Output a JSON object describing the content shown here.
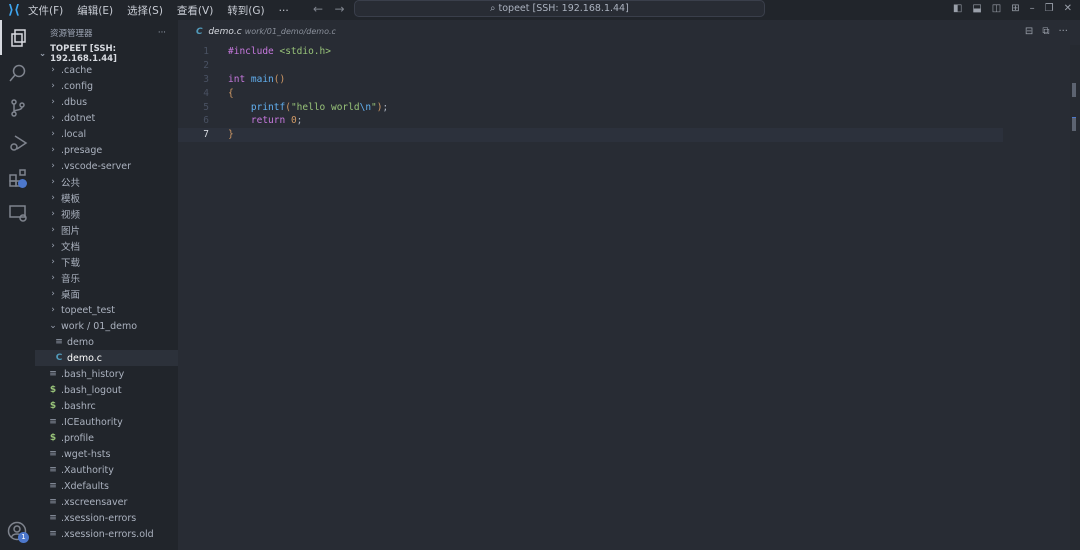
{
  "menu": [
    "文件(F)",
    "编辑(E)",
    "选择(S)",
    "查看(V)",
    "转到(G)",
    "···"
  ],
  "command_center": "topeet [SSH: 192.168.1.44]",
  "explorer": {
    "title": "资源管理器",
    "more": "···",
    "root": "TOPEET [SSH: 192.168.1.44]",
    "items": [
      {
        "type": "folder",
        "label": ".cache",
        "depth": 1
      },
      {
        "type": "folder",
        "label": ".config",
        "depth": 1
      },
      {
        "type": "folder",
        "label": ".dbus",
        "depth": 1
      },
      {
        "type": "folder",
        "label": ".dotnet",
        "depth": 1
      },
      {
        "type": "folder",
        "label": ".local",
        "depth": 1
      },
      {
        "type": "folder",
        "label": ".presage",
        "depth": 1
      },
      {
        "type": "folder",
        "label": ".vscode-server",
        "depth": 1
      },
      {
        "type": "folder",
        "label": "公共",
        "depth": 1
      },
      {
        "type": "folder",
        "label": "模板",
        "depth": 1
      },
      {
        "type": "folder",
        "label": "视频",
        "depth": 1
      },
      {
        "type": "folder",
        "label": "图片",
        "depth": 1
      },
      {
        "type": "folder",
        "label": "文档",
        "depth": 1
      },
      {
        "type": "folder",
        "label": "下载",
        "depth": 1
      },
      {
        "type": "folder",
        "label": "音乐",
        "depth": 1
      },
      {
        "type": "folder",
        "label": "桌面",
        "depth": 1
      },
      {
        "type": "folder",
        "label": "topeet_test",
        "depth": 1
      },
      {
        "type": "open-folder",
        "label": "work / 01_demo",
        "depth": 1
      },
      {
        "type": "file",
        "label": "demo",
        "depth": 2
      },
      {
        "type": "c",
        "label": "demo.c",
        "depth": 2,
        "selected": true
      },
      {
        "type": "file",
        "label": ".bash_history",
        "depth": 1
      },
      {
        "type": "shell",
        "label": ".bash_logout",
        "depth": 1
      },
      {
        "type": "shell",
        "label": ".bashrc",
        "depth": 1
      },
      {
        "type": "file",
        "label": ".ICEauthority",
        "depth": 1
      },
      {
        "type": "shell",
        "label": ".profile",
        "depth": 1
      },
      {
        "type": "file",
        "label": ".wget-hsts",
        "depth": 1
      },
      {
        "type": "file",
        "label": ".Xauthority",
        "depth": 1
      },
      {
        "type": "file",
        "label": ".Xdefaults",
        "depth": 1
      },
      {
        "type": "file",
        "label": ".xscreensaver",
        "depth": 1
      },
      {
        "type": "file",
        "label": ".xsession-errors",
        "depth": 1
      },
      {
        "type": "file",
        "label": ".xsession-errors.old",
        "depth": 1
      }
    ]
  },
  "tab": {
    "name": "demo.c",
    "path": "work/01_demo/demo.c",
    "icon": "C"
  },
  "account_badge": "1",
  "code": {
    "current_line": 7,
    "lines": [
      [
        [
          "kw",
          "#include "
        ],
        [
          "str",
          "<stdio.h>"
        ]
      ],
      [],
      [
        [
          "kw",
          "int "
        ],
        [
          "fn",
          "main"
        ],
        [
          "br",
          "()"
        ]
      ],
      [
        [
          "br",
          "{"
        ]
      ],
      [
        [
          "pn",
          "    "
        ],
        [
          "fn",
          "printf"
        ],
        [
          "br",
          "("
        ],
        [
          "str",
          "\"hello world"
        ],
        [
          "fn",
          "\\n"
        ],
        [
          "str",
          "\""
        ],
        [
          "br",
          ")"
        ],
        [
          "pn",
          ";"
        ]
      ],
      [
        [
          "pn",
          "    "
        ],
        [
          "kw",
          "return "
        ],
        [
          "num",
          "0"
        ],
        [
          "pn",
          ";"
        ]
      ],
      [
        [
          "br",
          "}"
        ]
      ]
    ]
  }
}
